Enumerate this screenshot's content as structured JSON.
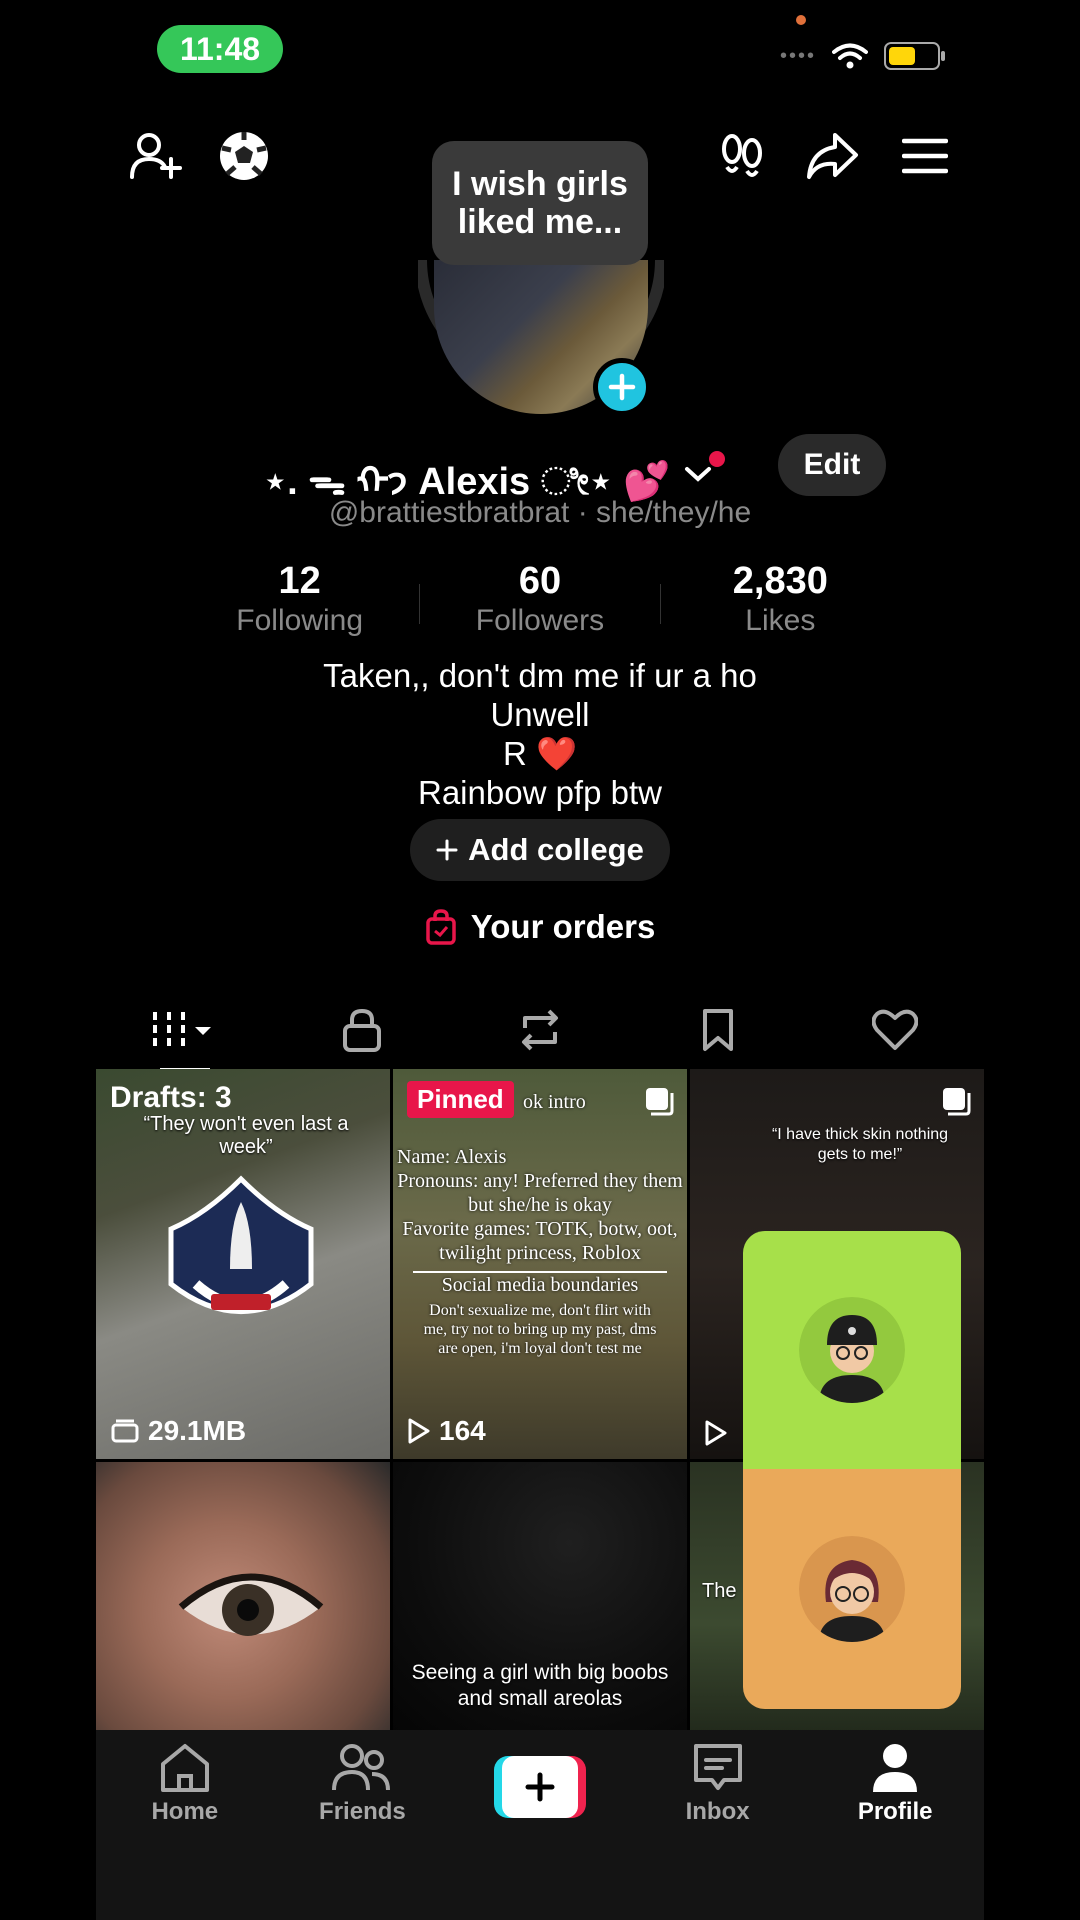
{
  "status_bar": {
    "time": "11:48",
    "signal_dots": "••••"
  },
  "profile": {
    "mood_bubble": "I wish girls liked me...",
    "display_name": "⋆. ᯓ ᡣ𐭩 Alexis ೀ⋆ 💕",
    "handle_line": "@brattiestbratbrat · she/they/he",
    "edit_label": "Edit",
    "stats": [
      {
        "value": "12",
        "label": "Following"
      },
      {
        "value": "60",
        "label": "Followers"
      },
      {
        "value": "2,830",
        "label": "Likes"
      }
    ],
    "bio": {
      "line1": "Taken,, don't dm me if ur a ho",
      "line2": "Unwell",
      "line3": "R",
      "heart": "❤️",
      "line4": "Rainbow pfp btw"
    },
    "add_college_label": "Add college",
    "orders_label": "Your orders"
  },
  "grid": {
    "cell1": {
      "drafts": "Drafts: 3",
      "caption": "“They won't even last a week”",
      "size": "29.1MB"
    },
    "cell2": {
      "pinned": "Pinned",
      "title": "ok intro",
      "lines": [
        "Name: Alexis",
        "Pronouns: any! Preferred they them but she/he is okay",
        "Favorite games: TOTK, botw, oot, twilight princess, Roblox",
        "Social media boundaries",
        "Don't sexualize me, don't flirt with me, try not to bring up my past, dms are open, i'm loyal don't test me"
      ],
      "views": "164"
    },
    "cell3": {
      "caption": "“I have thick skin nothing gets to me!”"
    },
    "cell5": {
      "caption": "Seeing a girl with big boobs and small areolas"
    },
    "cell6": {
      "caption": "The"
    }
  },
  "nav": {
    "home": "Home",
    "friends": "Friends",
    "inbox": "Inbox",
    "profile": "Profile"
  },
  "colors": {
    "accent_cyan": "#20c4e0",
    "accent_red": "#e8164a",
    "status_green": "#35c759",
    "card_green": "#a7e04a",
    "card_orange": "#eaa95a"
  }
}
